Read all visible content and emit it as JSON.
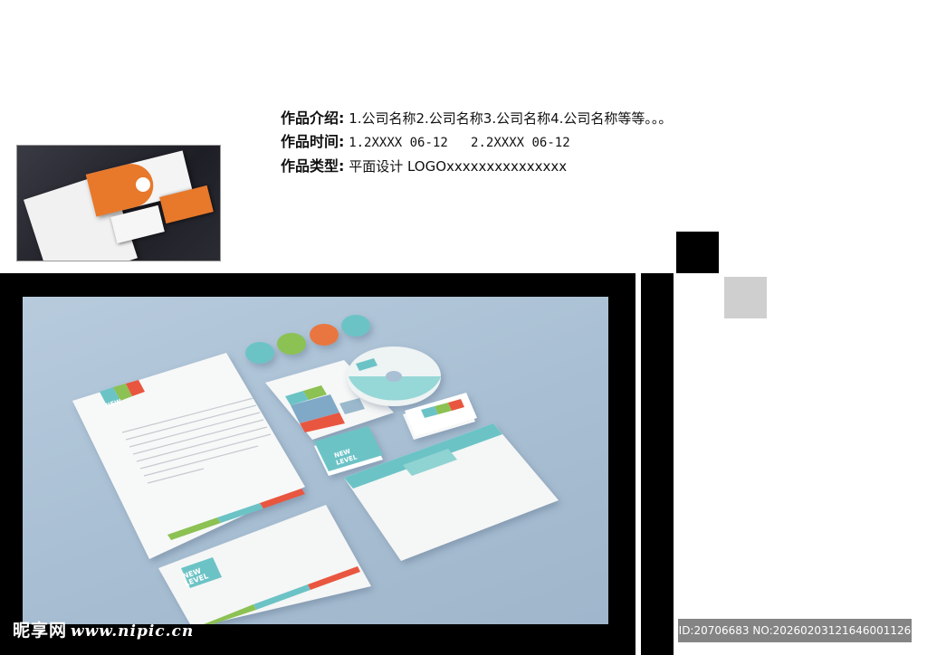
{
  "info": {
    "intro_label": "作品介绍:",
    "intro_value": "1.公司名称2.公司名称3.公司名称4.公司名称等等。。。",
    "time_label": "作品时间:",
    "time_value": "1.2XXXX 06-12   2.2XXXX 06-12",
    "type_label": "作品类型:",
    "type_value": "平面设计 LOGOxxxxxxxxxxxxxxx"
  },
  "mockup": {
    "brand_line1": "NEW",
    "brand_line2": "LEVEL",
    "accent_colors": [
      "#6cc3c6",
      "#8cc152",
      "#e9573f",
      "#f6bb42"
    ]
  },
  "watermark": {
    "site_name": "昵享网",
    "site_url": "www.nipic.cn",
    "id_text": "ID:20706683 NO:20260203121646001126"
  },
  "colors": {
    "frame": "#000000",
    "gray_square": "#cfcfcf",
    "thumb_orange": "#e8782a"
  }
}
